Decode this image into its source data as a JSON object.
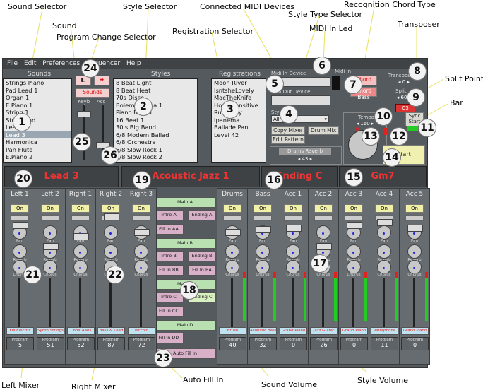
{
  "annotations": {
    "sound_selector": "Sound Selector",
    "sound": "Sound",
    "program_change_selector": "Program Change Selector",
    "style_selector": "Style Selector",
    "connected_midi_devices": "Connected MIDI Devices",
    "style_type_selector": "Style Type Selector",
    "recognition_chord_type": "Recognition Chord Type",
    "registration_selector": "Registration Selector",
    "midi_in_led": "MIDI In Led",
    "transposer": "Transposer",
    "split_point": "Split Point",
    "bar": "Bar",
    "left_mixer": "Left Mixer",
    "right_mixer": "Right Mixer",
    "auto_fill_in": "Auto Fill In",
    "sound_volume": "Sound Volume",
    "style_volume": "Style Volume"
  },
  "menu": [
    "File",
    "Edit",
    "Preferences",
    "Sequencer",
    "Help"
  ],
  "sounds": {
    "title": "Sounds",
    "items": [
      "Strings Piano",
      "Pad Lead 1",
      "Organ 1",
      "E Piano 1",
      "String 1",
      "String Pad",
      "Lead 2",
      "Lead 3",
      "Harmonica",
      "Pan Flute",
      "E.Piano 2",
      "E.Piano 3"
    ],
    "selected": 7
  },
  "styles": {
    "title": "Styles",
    "items": [
      "8 Beat Light",
      "8 Beat Heat",
      "70s Disco",
      "Bolero Rumba 1",
      "Piano Ballad",
      "16 Beat 1",
      "30's Big Band",
      "6/8 Modern Ballad",
      "6/8 Orchestra",
      "6/8 Slow Rock 1",
      "6/8 Slow Rock 2",
      "Beat 1"
    ]
  },
  "registrations": {
    "title": "Registrations",
    "items": [
      "Moon River",
      "IsntsheLovely",
      "MacTheKnife",
      "HowInsensitive",
      "Ruby Day",
      "Ipanema",
      "Ballade Pan",
      "Level 42"
    ]
  },
  "midi": {
    "in_device_label": "Midi In Device",
    "midi_in_label": "Midi In",
    "out_device_label": "Midi Out Device",
    "style_label": "Style",
    "style_value": "All",
    "copy_mixer": "Copy Mixer",
    "drum_mix": "Drum Mix",
    "edit_pattern": "Edit Pattern",
    "drums_reverb": "Drums Reverb",
    "drums_reverb_value": "43"
  },
  "sounds_button": "Sounds",
  "keyb_label": "Keyb",
  "acc_label": "Acc",
  "chord_button_top": "Chord",
  "chord_button_bottom": "Chord Bass",
  "transpose": {
    "label": "Transpose",
    "value": "0"
  },
  "split": {
    "label": "Split",
    "value": "60",
    "note": "C3"
  },
  "tempo": {
    "label": "Tempo",
    "value": "160"
  },
  "sync_start": "Sync Start",
  "start": "Start",
  "display": {
    "right_sound": "Lead 3",
    "style": "Acoustic Jazz 1",
    "ending": "Ending C",
    "chord": "Gm7"
  },
  "variations": {
    "main_a": "Main A",
    "intro_a": "Intro A",
    "ending_a": "Ending A",
    "fill_aa": "Fill In AA",
    "main_b": "Main B",
    "intro_b": "Intro B",
    "ending_b": "Ending B",
    "fill_bb": "Fill In BB",
    "fill_ba": "Fill In BA",
    "main_c": "Main C",
    "intro_c": "Intro C",
    "ending_c": "Ending C",
    "fill_cc": "Fill In CC",
    "main_d": "Main D",
    "fill_dd": "Fill In DD",
    "auto_fill": "Auto Fill In"
  },
  "knob_labels": {
    "pan": "Pan",
    "reverb": "Reverb",
    "chorus": "Chorus"
  },
  "on_label": "On",
  "program_label": "Program",
  "channels": [
    {
      "name": "Left 1",
      "instrument": "FM Electric",
      "program": "5"
    },
    {
      "name": "Left 2",
      "instrument": "Synth Strings",
      "program": "51"
    },
    {
      "name": "Right 1",
      "instrument": "Choir Aahs",
      "program": "52"
    },
    {
      "name": "Right 2",
      "instrument": "Bass & Lead",
      "program": "87"
    },
    {
      "name": "Right 3",
      "instrument": "Piccolo",
      "program": "72"
    },
    {
      "name": "Drums",
      "instrument": "Brush",
      "program": "40"
    },
    {
      "name": "Bass",
      "instrument": "Acoustic Bass",
      "program": "32"
    },
    {
      "name": "Acc 1",
      "instrument": "Grand Piano",
      "program": "0"
    },
    {
      "name": "Acc 2",
      "instrument": "Jazz Guitar",
      "program": "26"
    },
    {
      "name": "Acc 3",
      "instrument": "Grand Piano",
      "program": "0"
    },
    {
      "name": "Acc 4",
      "instrument": "Vibraphone",
      "program": "11"
    },
    {
      "name": "Acc 5",
      "instrument": "Grand Piano",
      "program": "0"
    }
  ],
  "markers": [
    "1",
    "2",
    "3",
    "4",
    "5",
    "6",
    "7",
    "8",
    "9",
    "10",
    "11",
    "12",
    "13",
    "14",
    "15",
    "16",
    "17",
    "18",
    "19",
    "20",
    "21",
    "22",
    "23",
    "24",
    "25",
    "26"
  ]
}
